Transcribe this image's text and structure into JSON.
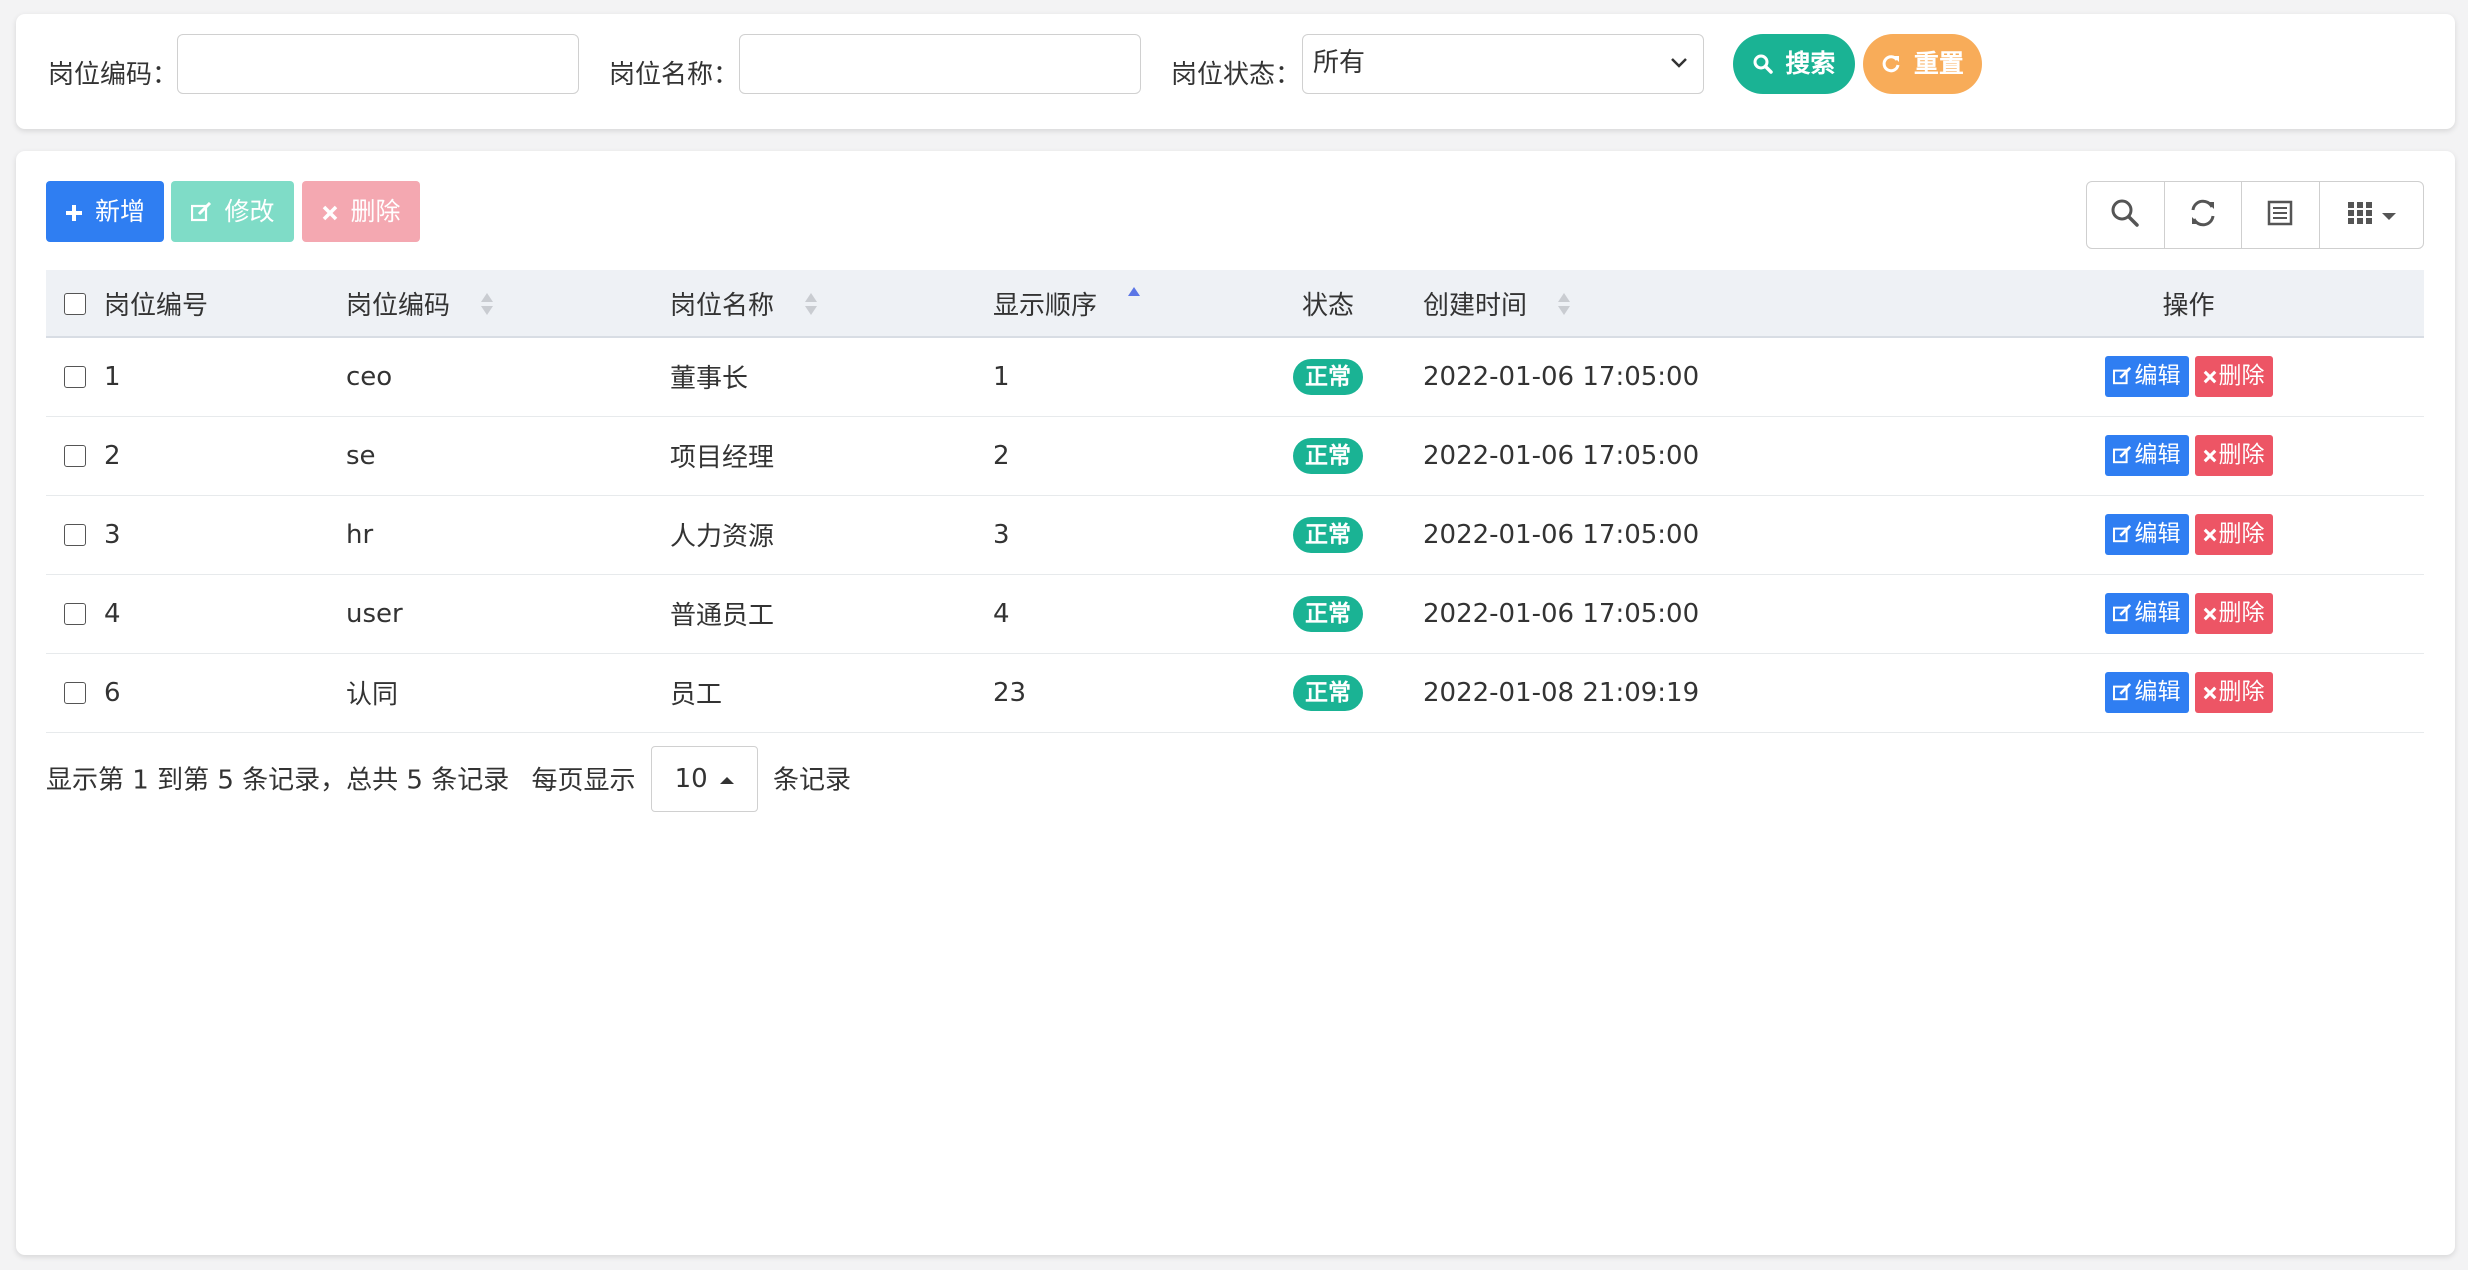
{
  "search": {
    "post_code_label": "岗位编码：",
    "post_code_value": "",
    "post_name_label": "岗位名称：",
    "post_name_value": "",
    "status_label": "岗位状态：",
    "status_selected": "所有",
    "search_btn": "搜索",
    "reset_btn": "重置"
  },
  "toolbar": {
    "add_label": "新增",
    "edit_label": "修改",
    "delete_label": "删除"
  },
  "table": {
    "columns": [
      "岗位编号",
      "岗位编码",
      "岗位名称",
      "显示顺序",
      "状态",
      "创建时间",
      "操作"
    ],
    "rows": [
      {
        "id": "1",
        "code": "ceo",
        "name": "董事长",
        "order": "1",
        "status": "正常",
        "created": "2022-01-06 17:05:00"
      },
      {
        "id": "2",
        "code": "se",
        "name": "项目经理",
        "order": "2",
        "status": "正常",
        "created": "2022-01-06 17:05:00"
      },
      {
        "id": "3",
        "code": "hr",
        "name": "人力资源",
        "order": "3",
        "status": "正常",
        "created": "2022-01-06 17:05:00"
      },
      {
        "id": "4",
        "code": "user",
        "name": "普通员工",
        "order": "4",
        "status": "正常",
        "created": "2022-01-06 17:05:00"
      },
      {
        "id": "6",
        "code": "认同",
        "name": "员工",
        "order": "23",
        "status": "正常",
        "created": "2022-01-08 21:09:19"
      }
    ],
    "row_edit": "编辑",
    "row_delete": "删除"
  },
  "pagination": {
    "summary": "显示第 1 到第 5 条记录，总共 5 条记录",
    "per_page_prefix": "每页显示",
    "per_page_value": "10",
    "per_page_suffix": "条记录"
  },
  "colors": {
    "primary": "#2f7ef2",
    "success": "#1ab394",
    "warning": "#f8ac59",
    "danger": "#ed5565"
  }
}
